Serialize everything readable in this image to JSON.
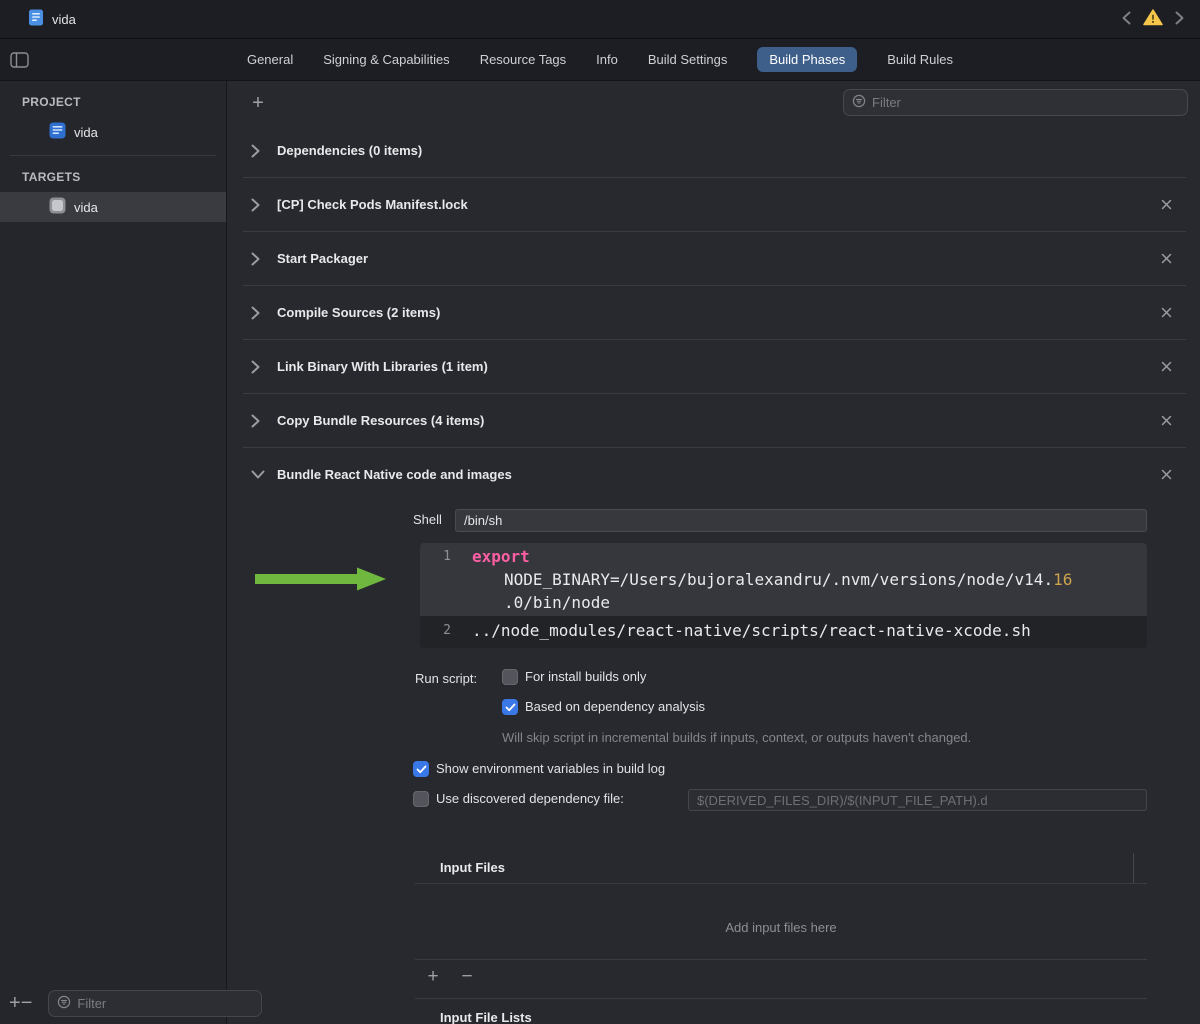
{
  "icons": {
    "add": "+",
    "remove": "−"
  },
  "titlebar": {
    "title": "vida"
  },
  "tabbar": {
    "tabs": [
      "General",
      "Signing & Capabilities",
      "Resource Tags",
      "Info",
      "Build Settings",
      "Build Phases",
      "Build Rules"
    ],
    "active_tab": "Build Phases"
  },
  "sidebar": {
    "project_header": "PROJECT",
    "project_name": "vida",
    "targets_header": "TARGETS",
    "target_name": "vida",
    "filter_placeholder": "Filter"
  },
  "main_toolbar": {
    "filter_placeholder": "Filter"
  },
  "phases": [
    {
      "title": "Dependencies (0 items)",
      "expanded": false,
      "closable": false
    },
    {
      "title": "[CP] Check Pods Manifest.lock",
      "expanded": false,
      "closable": true
    },
    {
      "title": "Start Packager",
      "expanded": false,
      "closable": true
    },
    {
      "title": "Compile Sources (2 items)",
      "expanded": false,
      "closable": true
    },
    {
      "title": "Link Binary With Libraries (1 item)",
      "expanded": false,
      "closable": true
    },
    {
      "title": "Copy Bundle Resources (4 items)",
      "expanded": false,
      "closable": true
    },
    {
      "title": "Bundle React Native code and images",
      "expanded": true,
      "closable": true
    }
  ],
  "script": {
    "shell_label": "Shell",
    "shell_value": "/bin/sh",
    "code": {
      "line1_num": "1",
      "line1_keyword": "export",
      "line1_wrap1_text": "NODE_BINARY=/Users/bujoralexandru/.nvm/versions/node/v14.",
      "line1_wrap1_number": "16",
      "line1_wrap2_text": ".0/bin/node",
      "line2_num": "2",
      "line2_text": "../node_modules/react-native/scripts/react-native-xcode.sh"
    },
    "run_script_label": "Run script:",
    "checkboxes": {
      "for_install": {
        "label": "For install builds only",
        "checked": false
      },
      "dependency_analysis": {
        "label": "Based on dependency analysis",
        "checked": true
      },
      "show_env": {
        "label": "Show environment variables in build log",
        "checked": true
      },
      "discovered_file": {
        "label": "Use discovered dependency file:",
        "checked": false
      }
    },
    "dependency_note": "Will skip script in incremental builds if inputs, context, or outputs haven't changed.",
    "discovered_file_value": "$(DERIVED_FILES_DIR)/$(INPUT_FILE_PATH).d",
    "input_files_header": "Input Files",
    "input_files_empty": "Add input files here",
    "input_file_lists_header": "Input File Lists"
  },
  "colors": {
    "selected_tab": "#3e5f8a",
    "checkbox_blue": "#3b78e7",
    "keyword_pink": "#fc5fa3",
    "number_literal": "#cda24d",
    "arrow_green": "#6fb73e",
    "warning_yellow": "#f5c64a",
    "selected_row": "#3a3b41"
  }
}
